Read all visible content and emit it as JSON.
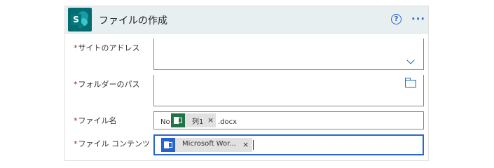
{
  "header": {
    "title": "ファイルの作成",
    "help_glyph": "?",
    "more_glyph": "···",
    "app_letter": "S"
  },
  "fields": {
    "site_address": {
      "label": "サイトのアドレス",
      "required_mark": "*",
      "value": ""
    },
    "folder_path": {
      "label": "フォルダーのパス",
      "required_mark": "*",
      "value": ""
    },
    "file_name": {
      "label": "ファイル名",
      "required_mark": "*",
      "prefix": "No",
      "token_label": "列1",
      "token_remove": "×",
      "suffix": ".docx"
    },
    "file_content": {
      "label": "ファイル コンテンツ",
      "required_mark": "*",
      "token_label": "Microsoft Wor...",
      "token_remove": "×"
    }
  },
  "colors": {
    "header_bg": "#e8eff0",
    "accent_blue": "#2b67c9",
    "required_red": "#a4262c",
    "excel_green": "#217346",
    "word_blue": "#2564cf",
    "sharepoint_teal": "#036c70"
  },
  "icons": [
    "sharepoint-icon",
    "help-icon",
    "more-icon",
    "chevron-down-icon",
    "folder-icon",
    "excel-icon",
    "office-icon"
  ]
}
